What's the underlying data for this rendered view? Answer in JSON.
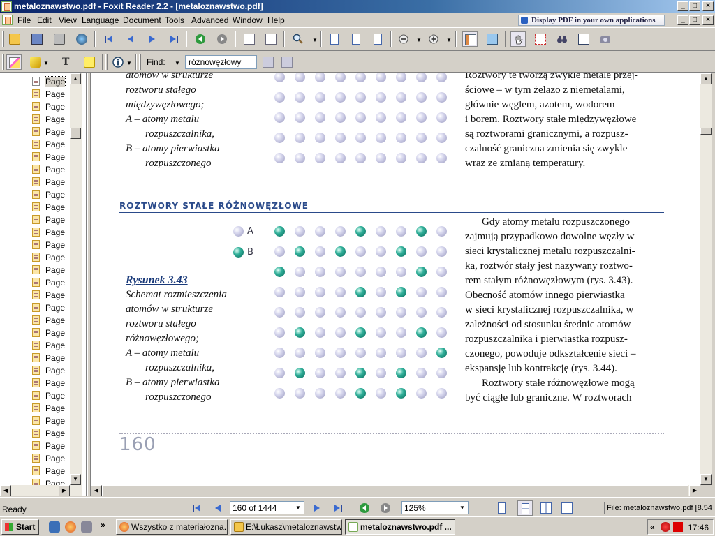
{
  "window": {
    "title": "metaloznawstwo.pdf - Foxit Reader 2.2 - [metaloznawstwo.pdf]",
    "controls": {
      "minimize": "_",
      "maximize": "□",
      "close": "×"
    }
  },
  "menu": {
    "items": [
      "File",
      "Edit",
      "View",
      "Language",
      "Document",
      "Tools",
      "Advanced",
      "Window",
      "Help"
    ],
    "ad": "Display PDF in your own applications"
  },
  "toolbar": {
    "find_label": "Find:",
    "find_value": "różnowęzłowy"
  },
  "sidebar": {
    "page_label": "Page",
    "row_count": 33
  },
  "document": {
    "top_caption": [
      "atomów w strukturze",
      "roztworu stałego",
      "międzywęzłowego;",
      "A – atomy metalu",
      "rozpuszczalnika,",
      "B – atomy pierwiastka",
      "rozpuszczonego"
    ],
    "top_right_text": [
      "Roztwory te tworzą zwykle metale przej-",
      "ściowe – w tym żelazo z niemetalami,",
      "głównie węglem, azotem, wodorem",
      "i borem. Roztwory stałe międzywęzłowe",
      "są roztworami granicznymi, a rozpusz-",
      "czalność graniczna zmienia się zwykle",
      "wraz ze zmianą temperatury."
    ],
    "section_title": "ROZTWORY STAŁE RÓŻNOWĘZŁOWE",
    "legend_a": "A",
    "legend_b": "B",
    "figure_title": "Rysunek 3.43",
    "figure_caption": [
      "Schemat rozmieszczenia",
      "atomów w strukturze",
      "roztworu stałego",
      "różnowęzłowego;",
      "A – atomy metalu",
      "rozpuszczalnika,",
      "B – atomy pierwiastka",
      "rozpuszczonego"
    ],
    "body_text": [
      "Gdy atomy metalu rozpuszczonego",
      "zajmują przypadkowo dowolne węzły w",
      "sieci krystalicznej metalu rozpuszczalni-",
      "ka, roztwór stały jest nazywany roztwo-",
      "rem stałym różnowęzłowym (rys. 3.43).",
      "Obecność atomów innego pierwiastka",
      "w sieci krystalicznej rozpuszczalnika, w",
      "zależności od stosunku średnic atomów",
      "rozpuszczalnika i pierwiastka rozpusz-",
      "czonego, powoduje odkształcenie sieci –",
      "ekspansję lub kontrakcję (rys. 3.44).",
      "Roztwory stałe różnowęzłowe mogą",
      "być ciągłe lub graniczne. W roztworach"
    ],
    "page_number": "160"
  },
  "status": {
    "ready": "Ready",
    "page_field": "160 of 1444",
    "zoom_field": "125%",
    "file_info": "File: metaloznawstwo.pdf [8.54"
  },
  "taskbar": {
    "start": "Start",
    "tasks": [
      "Wszystko z materiałozna...",
      "E:\\Łukasz\\metaloznawstwo",
      "metaloznawstwo.pdf ..."
    ],
    "clock": "17:46",
    "tray_chevron": "«",
    "ql_more": "»"
  }
}
